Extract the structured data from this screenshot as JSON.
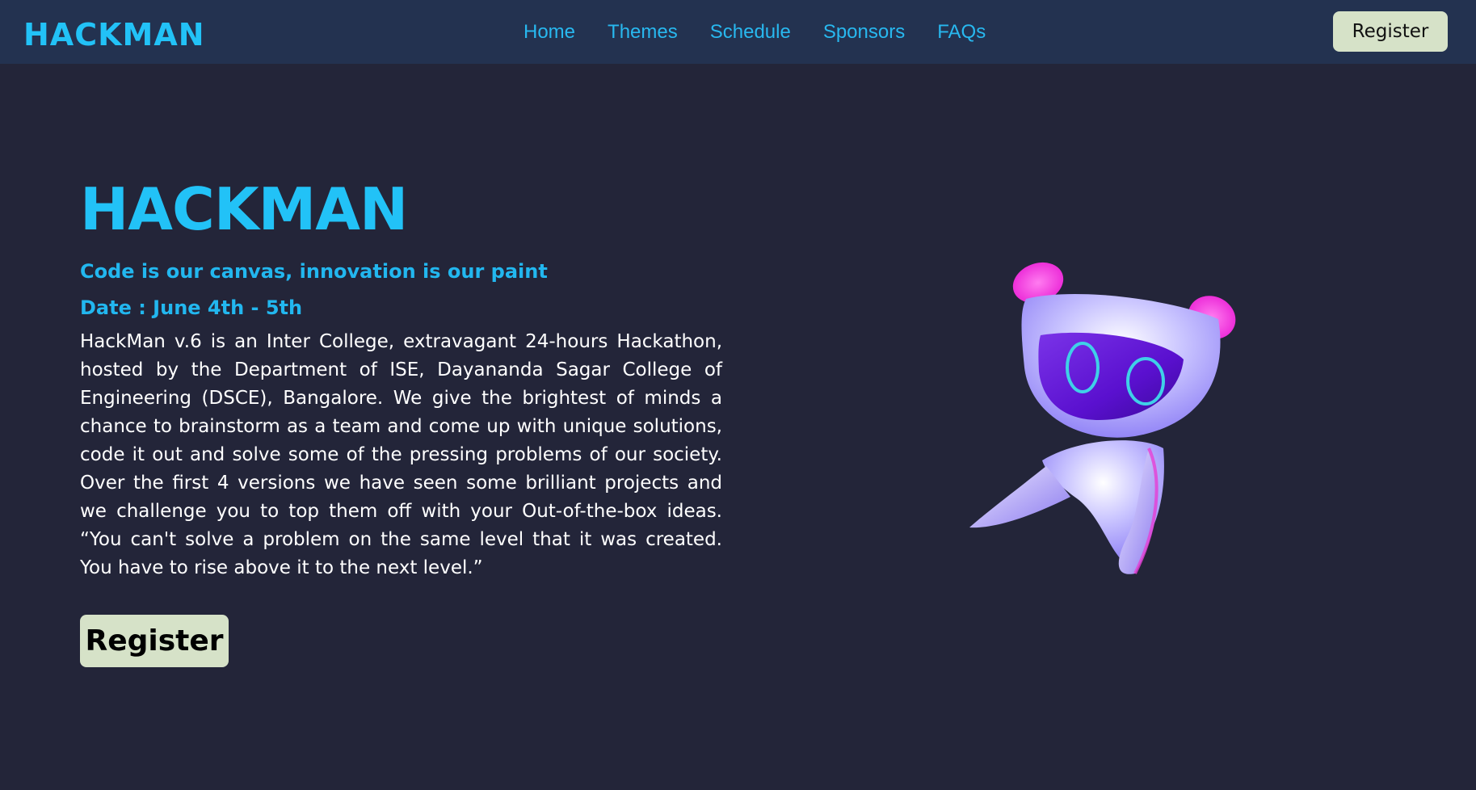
{
  "brand": {
    "logo_text": "HACKMAN",
    "accent_color": "#22c2f7"
  },
  "nav": {
    "links": [
      "Home",
      "Themes",
      "Schedule",
      "Sponsors",
      "FAQs"
    ],
    "register_label": "Register",
    "register_bg": "#d6e2c8"
  },
  "hero": {
    "title": "HACKMAN",
    "tagline": "Code is our canvas, innovation is our paint",
    "date": "Date : June 4th - 5th",
    "description": "HackMan v.6 is an Inter College, extravagant 24-hours Hackathon, hosted by the Department of ISE, Dayananda Sagar College of Engineering (DSCE), Bangalore. We give the brightest of minds a chance to brainstorm as a team and come up with unique solutions, code it out and solve some of the pressing problems of our society. Over the first 4 versions we have seen some brilliant projects and we challenge you to top them off with your Out-of-the-box ideas. “You can't solve a problem on the same level that it was created. You have to rise above it to the next level.”",
    "register_label": "Register"
  },
  "mascot": {
    "icon": "robot-mascot"
  }
}
